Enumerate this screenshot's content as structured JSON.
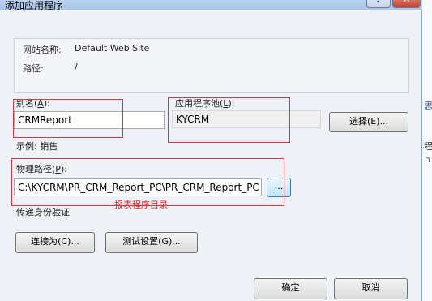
{
  "window": {
    "title": "添加应用程序",
    "help_label": "?",
    "close_label": "✕"
  },
  "site_info": {
    "site_name_label": "网站名称:",
    "site_name_value": "Default Web Site",
    "path_label": "路径:",
    "path_value": "/"
  },
  "alias": {
    "label": "别名",
    "accel_prefix": "(",
    "accel_key": "A",
    "accel_suffix": "):",
    "value": "CRMReport",
    "example": "示例: 销售"
  },
  "app_pool": {
    "label": "应用程序池",
    "accel_prefix": "(",
    "accel_key": "L",
    "accel_suffix": "):",
    "value": "KYCRM",
    "select_button": "选择(E)..."
  },
  "physical_path": {
    "label": "物理路径",
    "accel_prefix": "(",
    "accel_key": "P",
    "accel_suffix": "):",
    "value": "C:\\KYCRM\\PR_CRM_Report_PC\\PR_CRM_Report_PC",
    "browse_button": "...",
    "annotation": "报表程序目录"
  },
  "pass_through_auth": {
    "label": "传递身份验证"
  },
  "buttons": {
    "connect_as": "连接为(C)...",
    "test_settings": "测试设置(G)...",
    "ok": "确定",
    "cancel": "取消"
  },
  "background": {
    "fragment_1": "思",
    "fragment_2": "程",
    "fragment_3": "h"
  },
  "colors": {
    "annotation_red": "#e02020",
    "title_bar": "#b8d1ee",
    "dialog_bg": "#eef1f5"
  }
}
